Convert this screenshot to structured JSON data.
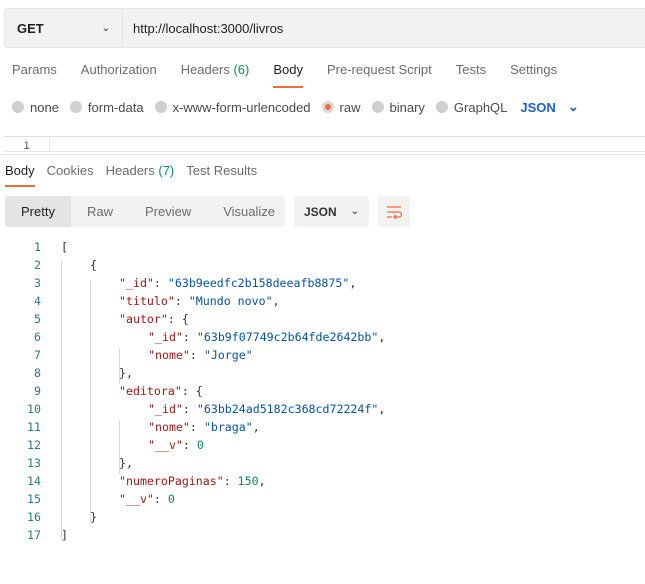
{
  "request": {
    "method": "GET",
    "url": "http://localhost:3000/livros"
  },
  "request_tabs": [
    {
      "label": "Params"
    },
    {
      "label": "Authorization"
    },
    {
      "label": "Headers",
      "count": "(6)"
    },
    {
      "label": "Body",
      "active": true
    },
    {
      "label": "Pre-request Script"
    },
    {
      "label": "Tests"
    },
    {
      "label": "Settings"
    }
  ],
  "body_types": [
    {
      "label": "none"
    },
    {
      "label": "form-data"
    },
    {
      "label": "x-www-form-urlencoded"
    },
    {
      "label": "raw",
      "selected": true
    },
    {
      "label": "binary"
    },
    {
      "label": "GraphQL"
    }
  ],
  "body_format": "JSON",
  "editor_line": "1",
  "response_tabs": [
    {
      "label": "Body",
      "active": true
    },
    {
      "label": "Cookies"
    },
    {
      "label": "Headers",
      "count": "(7)"
    },
    {
      "label": "Test Results"
    }
  ],
  "view_modes": [
    {
      "label": "Pretty",
      "active": true
    },
    {
      "label": "Raw"
    },
    {
      "label": "Preview"
    },
    {
      "label": "Visualize"
    }
  ],
  "response_format": "JSON",
  "colors": {
    "accent": "#f26b3a",
    "key": "#a31515",
    "string": "#0451a5",
    "number": "#098658",
    "line_number": "#237893"
  },
  "code_lines": [
    {
      "n": "1",
      "indent": 0,
      "t": [
        [
          "p",
          "["
        ]
      ]
    },
    {
      "n": "2",
      "indent": 1,
      "t": [
        [
          "p",
          "{"
        ]
      ]
    },
    {
      "n": "3",
      "indent": 2,
      "t": [
        [
          "k",
          "\"_id\""
        ],
        [
          "p",
          ": "
        ],
        [
          "s",
          "\"63b9eedfc2b158deeafb8875\""
        ],
        [
          "p",
          ","
        ]
      ]
    },
    {
      "n": "4",
      "indent": 2,
      "t": [
        [
          "k",
          "\"titulo\""
        ],
        [
          "p",
          ": "
        ],
        [
          "s",
          "\"Mundo novo\""
        ],
        [
          "p",
          ","
        ]
      ]
    },
    {
      "n": "5",
      "indent": 2,
      "t": [
        [
          "k",
          "\"autor\""
        ],
        [
          "p",
          ": {"
        ]
      ]
    },
    {
      "n": "6",
      "indent": 3,
      "t": [
        [
          "k",
          "\"_id\""
        ],
        [
          "p",
          ": "
        ],
        [
          "s",
          "\"63b9f07749c2b64fde2642bb\""
        ],
        [
          "p",
          ","
        ]
      ]
    },
    {
      "n": "7",
      "indent": 3,
      "t": [
        [
          "k",
          "\"nome\""
        ],
        [
          "p",
          ": "
        ],
        [
          "s",
          "\"Jorge\""
        ]
      ]
    },
    {
      "n": "8",
      "indent": 2,
      "t": [
        [
          "p",
          "},"
        ]
      ]
    },
    {
      "n": "9",
      "indent": 2,
      "t": [
        [
          "k",
          "\"editora\""
        ],
        [
          "p",
          ": {"
        ]
      ]
    },
    {
      "n": "10",
      "indent": 3,
      "t": [
        [
          "k",
          "\"_id\""
        ],
        [
          "p",
          ": "
        ],
        [
          "s",
          "\"63bb24ad5182c368cd72224f\""
        ],
        [
          "p",
          ","
        ]
      ]
    },
    {
      "n": "11",
      "indent": 3,
      "t": [
        [
          "k",
          "\"nome\""
        ],
        [
          "p",
          ": "
        ],
        [
          "s",
          "\"braga\""
        ],
        [
          "p",
          ","
        ]
      ]
    },
    {
      "n": "12",
      "indent": 3,
      "t": [
        [
          "k",
          "\"__v\""
        ],
        [
          "p",
          ": "
        ],
        [
          "n",
          "0"
        ]
      ]
    },
    {
      "n": "13",
      "indent": 2,
      "t": [
        [
          "p",
          "},"
        ]
      ]
    },
    {
      "n": "14",
      "indent": 2,
      "t": [
        [
          "k",
          "\"numeroPaginas\""
        ],
        [
          "p",
          ": "
        ],
        [
          "n",
          "150"
        ],
        [
          "p",
          ","
        ]
      ]
    },
    {
      "n": "15",
      "indent": 2,
      "t": [
        [
          "k",
          "\"__v\""
        ],
        [
          "p",
          ": "
        ],
        [
          "n",
          "0"
        ]
      ]
    },
    {
      "n": "16",
      "indent": 1,
      "t": [
        [
          "p",
          "}"
        ]
      ]
    },
    {
      "n": "17",
      "indent": 0,
      "t": [
        [
          "p",
          "]"
        ]
      ]
    }
  ]
}
